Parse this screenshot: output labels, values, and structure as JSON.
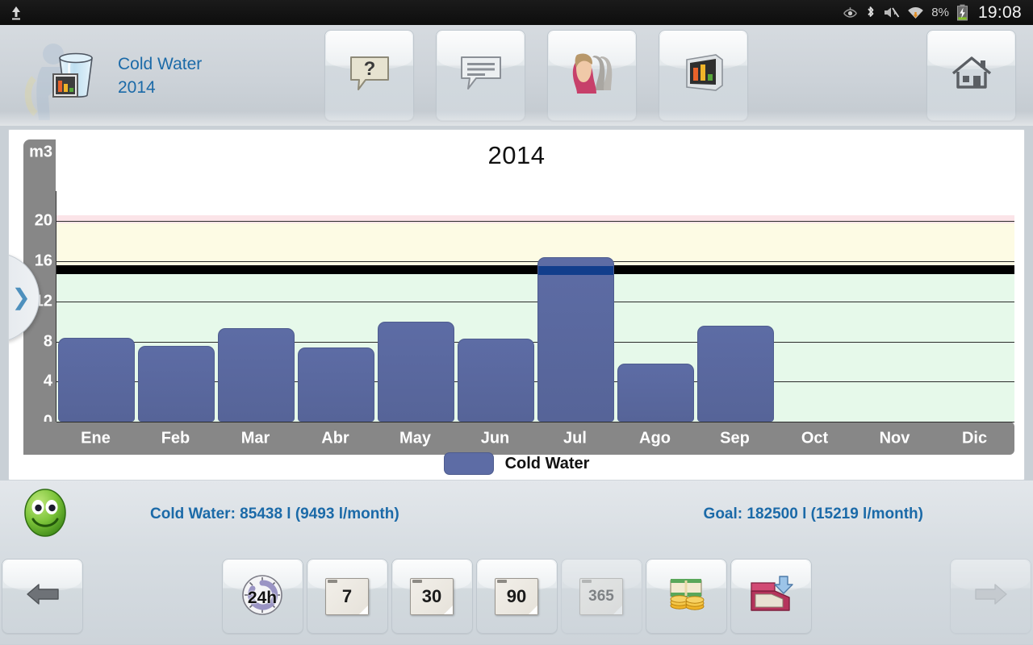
{
  "statusbar": {
    "upload_icon": "upload-icon",
    "icons": [
      "eye-icon",
      "bluetooth-icon",
      "mute-icon",
      "wifi-data-icon"
    ],
    "battery_percent": "8%",
    "battery_icon": "battery-charging-icon",
    "clock": "19:08"
  },
  "header": {
    "app_icon": "water-glass-chart-icon",
    "title": "Cold Water",
    "subtitle": "2014",
    "buttons": [
      {
        "name": "help-button",
        "icon": "question-bubble-icon"
      },
      {
        "name": "comments-button",
        "icon": "speech-bubble-icon"
      },
      {
        "name": "users-button",
        "icon": "people-profiles-icon"
      },
      {
        "name": "chart-view-button",
        "icon": "bar-chart-screen-icon"
      }
    ],
    "home_button": {
      "name": "home-button",
      "icon": "home-icon"
    },
    "slideout": {
      "name": "slide-out-panel-handle",
      "icon": "chevron-right-icon",
      "glyph": "❯"
    }
  },
  "chart_data": {
    "type": "bar",
    "title": "2014",
    "xlabel": "",
    "ylabel": "m3",
    "categories": [
      "Ene",
      "Feb",
      "Mar",
      "Abr",
      "May",
      "Jun",
      "Jul",
      "Ago",
      "Sep",
      "Oct",
      "Nov",
      "Dic"
    ],
    "series": [
      {
        "name": "Cold Water",
        "color": "#5d6ca5",
        "values": [
          8.4,
          7.6,
          9.3,
          7.4,
          10.0,
          8.3,
          16.4,
          5.8,
          9.6,
          0,
          0,
          0
        ]
      }
    ],
    "values": [
      8.4,
      7.6,
      9.3,
      7.4,
      10.0,
      8.3,
      16.4,
      5.8,
      9.6,
      0,
      0,
      0
    ],
    "ylim": [
      0,
      23
    ],
    "yticks": [
      0,
      4,
      8,
      12,
      16,
      20
    ],
    "ytick_labels": [
      "0",
      "4",
      "8",
      "12",
      "16",
      "20"
    ],
    "y_axis_unit": "m3",
    "grid": true,
    "legend_position": "bottom",
    "legend": [
      {
        "label": "Cold Water",
        "color": "#5d6ca5"
      }
    ],
    "goal_line": {
      "value": 15.2,
      "color": "#000000",
      "label": "Goal"
    },
    "bands": [
      {
        "from": 0,
        "to": 15.2,
        "color": "#e6f9ea",
        "name": "ok-band"
      },
      {
        "from": 15.6,
        "to": 19.8,
        "color": "#fdfbe4",
        "name": "warning-band"
      },
      {
        "from": 19.8,
        "to": 20.6,
        "color": "#fbe4e8",
        "name": "danger-band"
      }
    ],
    "over_goal_color": "#123e8c"
  },
  "summary": {
    "status_icon": "green-smiley-icon",
    "consumption": "Cold Water: 85438 l (9493 l/month)",
    "goal": "Goal: 182500 l (15219 l/month)"
  },
  "bottombar": {
    "prev_button": {
      "name": "previous-period-button",
      "icon": "arrow-left-icon"
    },
    "next_button": {
      "name": "next-period-button",
      "icon": "arrow-right-icon",
      "disabled": true
    },
    "range_buttons": [
      {
        "name": "range-24h-button",
        "label": "24h",
        "icon": "clock-24h-icon",
        "disabled": false
      },
      {
        "name": "range-7-button",
        "label": "7",
        "icon": "calendar-icon",
        "disabled": false
      },
      {
        "name": "range-30-button",
        "label": "30",
        "icon": "calendar-icon",
        "disabled": false
      },
      {
        "name": "range-90-button",
        "label": "90",
        "icon": "calendar-icon",
        "disabled": false
      },
      {
        "name": "range-365-button",
        "label": "365",
        "icon": "calendar-icon",
        "disabled": true
      }
    ],
    "cost_button": {
      "name": "cost-button",
      "icon": "money-coins-icon"
    },
    "export_button": {
      "name": "export-button",
      "icon": "archive-download-icon"
    }
  }
}
